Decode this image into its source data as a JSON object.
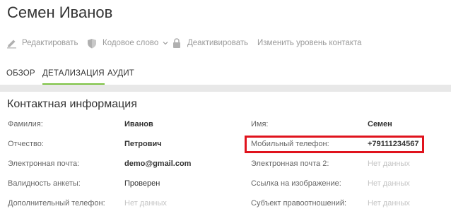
{
  "page_title": "Семен Иванов",
  "toolbar": {
    "edit": {
      "label": "Редактировать",
      "icon": "pencil-icon"
    },
    "codeword": {
      "label": "Кодовое слово",
      "icon": "shield-icon",
      "dropdown_icon": "chevron-down-icon"
    },
    "deactivate": {
      "label": "Деактивировать",
      "icon": "lock-icon"
    },
    "change_level": {
      "label": "Изменить уровень контакта"
    }
  },
  "tabs": [
    {
      "label": "ОБЗОР",
      "active": false
    },
    {
      "label": "ДЕТАЛИЗАЦИЯ",
      "active": true
    },
    {
      "label": "АУДИТ",
      "active": false
    }
  ],
  "accent_color": "#7dc243",
  "highlight_color": "#e0131d",
  "contact": {
    "title": "Контактная информация",
    "left": [
      {
        "label": "Фамилия:",
        "value": "Иванов"
      },
      {
        "label": "Отчество:",
        "value": "Петрович"
      },
      {
        "label": "Электронная почта:",
        "value": "demo@gmail.com"
      },
      {
        "label": "Валидность анкеты:",
        "value": "Проверен"
      },
      {
        "label": "Дополнительный телефон:",
        "value": "Нет данных"
      }
    ],
    "right": [
      {
        "label": "Имя:",
        "value": "Семен"
      },
      {
        "label": "Мобильный телефон:",
        "value": "+79111234567"
      },
      {
        "label": "Электронная почта 2:",
        "value": "Нет данных"
      },
      {
        "label": "Ссылка на изображение:",
        "value": "Нет данных"
      },
      {
        "label": "Субъект правоотношений:",
        "value": "Нет данных"
      }
    ]
  }
}
